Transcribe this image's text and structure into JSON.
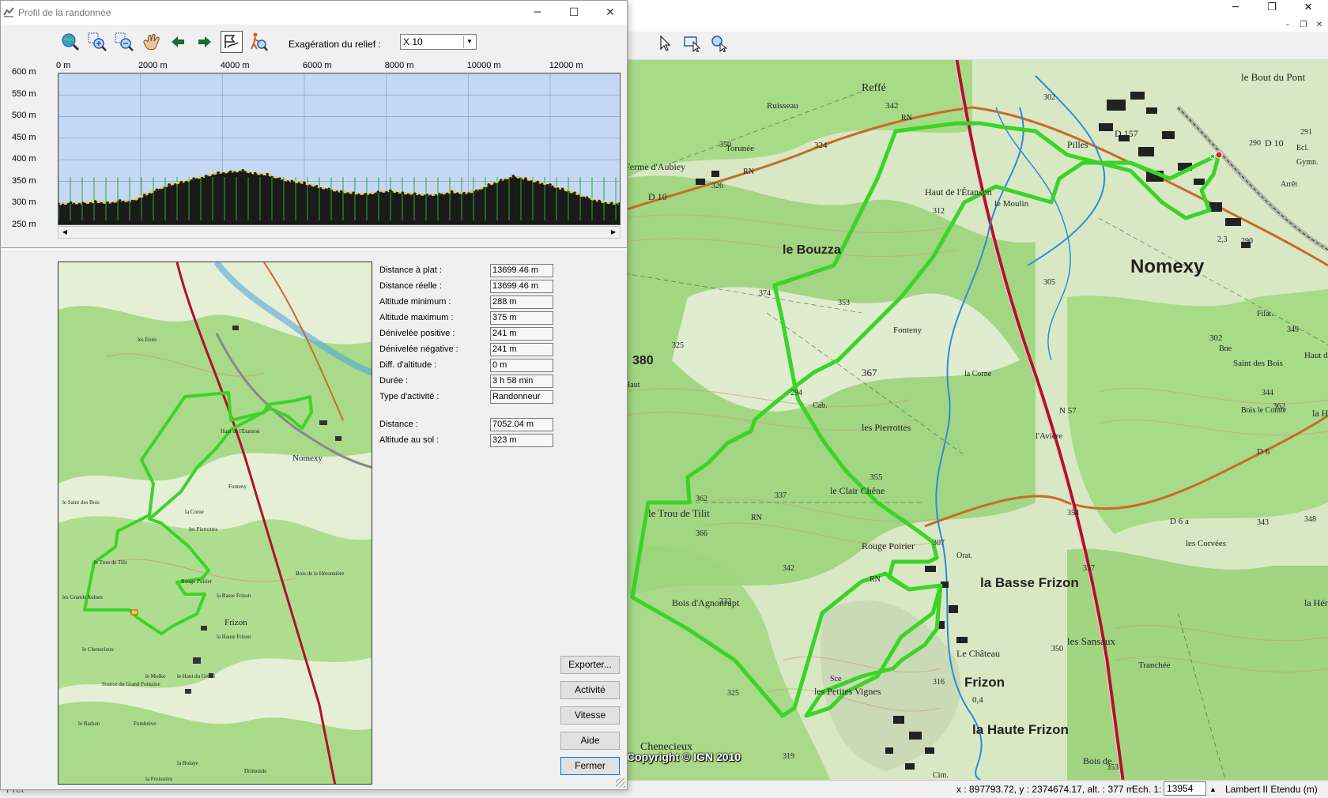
{
  "main_window": {
    "controls": {
      "minimize": "─",
      "maximize": "❐",
      "close": "✕"
    },
    "mdi_controls": {
      "minimize": "–",
      "restore": "❐",
      "close": "✕"
    }
  },
  "map": {
    "copyright": "Copyright © IGN 2010",
    "labels": [
      "Reffé",
      "342",
      "RN",
      "324",
      "Ruisseau",
      "350",
      "Ferme d'Aubiey",
      "Torunée",
      "326",
      "D 10",
      "RN",
      "le Bout du Pont",
      "302",
      "Pilles",
      "D 157",
      "291",
      "D 10",
      "290",
      "Ecl.",
      "Gymn.",
      "Arrêt",
      "Haut de l'Étanson",
      "312",
      "le Moulin",
      "le Bouzza",
      "Nomexy",
      "2,3",
      "290",
      "305",
      "374",
      "353",
      "Fonteny",
      "Filat.",
      "302",
      "Bne",
      "349",
      "325",
      "380",
      "Saint des Bois",
      "Haut du Camp",
      "Haut",
      "367",
      "la Corne",
      "294",
      "Cab.",
      "362",
      "Bois le Comte",
      "344",
      "la Héronnière",
      "les Pierrottes",
      "N 57",
      "D 6",
      "l'Avière",
      "355",
      "le Clair Chêne",
      "337",
      "362",
      "le Trou de Tilit",
      "RN",
      "366",
      "D 6 a",
      "les Corvées",
      "354",
      "348",
      "343",
      "Rouge Poirier",
      "307",
      "Orat.",
      "342",
      "RN",
      "la Basse Frizon",
      "357",
      "Bois d'Agnonrupt",
      "332",
      "la Héronnière",
      "les Sansaux",
      "Le Château",
      "Frizon",
      "0,4",
      "Sce",
      "les Petites Vignes",
      "316",
      "325",
      "Tranchée",
      "Bois de",
      "la Haute Frizon",
      "319",
      "Chenecieux",
      "353",
      "Cim.",
      "350"
    ]
  },
  "status_bar": {
    "coords": "x : 897793.72, y : 2374674.17, alt. : 377 m",
    "scale_label": "Ech. 1:",
    "scale_value": "13954",
    "projection": "Lambert II Etendu (m)",
    "left_text": "Prêt"
  },
  "dialog": {
    "title": "Profil de la randonnée",
    "controls": {
      "minimize": "─",
      "maximize": "☐",
      "close": "✕"
    },
    "toolbar_icons": [
      "globe-zoom-icon",
      "zoom-in-icon",
      "zoom-out-icon",
      "hand-pan-icon",
      "arrow-left-icon",
      "arrow-right-icon",
      "profile-flag-icon",
      "hiker-search-icon"
    ],
    "relief_label": "Exagération du relief :",
    "relief_value": "X 10",
    "x_ticks": [
      "0 m",
      "2000 m",
      "4000 m",
      "6000 m",
      "8000 m",
      "10000 m",
      "12000 m"
    ],
    "y_ticks": [
      "600 m",
      "550 m",
      "500 m",
      "450 m",
      "400 m",
      "350 m",
      "300 m",
      "250 m"
    ],
    "stats": [
      {
        "label": "Distance à plat :",
        "value": "13699.46 m"
      },
      {
        "label": "Distance réelle :",
        "value": "13699.46 m"
      },
      {
        "label": "Altitude minimum :",
        "value": "288 m"
      },
      {
        "label": "Altitude maximum :",
        "value": "375 m"
      },
      {
        "label": "Dénivelée positive :",
        "value": "241 m"
      },
      {
        "label": "Dénivelée négative :",
        "value": "241 m"
      },
      {
        "label": "Diff. d'altitude :",
        "value": "0 m"
      },
      {
        "label": "Durée :",
        "value": "3 h 58 min"
      },
      {
        "label": "Type d'activité :",
        "value": "Randonneur"
      }
    ],
    "stats2": [
      {
        "label": "Distance :",
        "value": "7052.04 m"
      },
      {
        "label": "Altitude au sol :",
        "value": "323 m"
      }
    ],
    "buttons": {
      "export": "Exporter...",
      "activity": "Activité",
      "speed": "Vitesse",
      "help": "Aide",
      "close": "Fermer"
    },
    "mini_map_labels": [
      "les Etots",
      "Nomexy",
      "la Basse Frizon",
      "Frizon",
      "la Haute Frizon",
      "le Saint des Bois",
      "le Chenecieux",
      "le Trou de Tilit",
      "Rouge Poirier",
      "Haut de l'Étanson",
      "Fonteny",
      "la Corne",
      "les Pierrottes",
      "Bois de la Héronnière",
      "le Haut du Grésil",
      "Fombrève",
      "la Bolaye",
      "le Barban",
      "Source du Grand Fontaine",
      "les Grands Aulnes",
      "le Molko",
      "la Froissière",
      "Drimonde"
    ]
  },
  "chart_data": {
    "type": "area",
    "title": "",
    "xlabel": "",
    "ylabel": "",
    "xlim": [
      0,
      13699
    ],
    "ylim": [
      250,
      600
    ],
    "x": [
      0,
      300,
      600,
      900,
      1200,
      1500,
      1800,
      2100,
      2400,
      2700,
      3000,
      3300,
      3600,
      3900,
      4200,
      4500,
      4800,
      5100,
      5400,
      5700,
      6000,
      6300,
      6600,
      6900,
      7200,
      7500,
      7800,
      8100,
      8400,
      8700,
      9000,
      9300,
      9600,
      9900,
      10200,
      10500,
      10800,
      11100,
      11400,
      11700,
      12000,
      12300,
      12600,
      12900,
      13200,
      13500,
      13699
    ],
    "y": [
      297,
      300,
      299,
      303,
      300,
      305,
      304,
      318,
      330,
      342,
      348,
      356,
      362,
      370,
      372,
      375,
      368,
      366,
      356,
      350,
      346,
      338,
      332,
      326,
      323,
      320,
      325,
      328,
      323,
      321,
      318,
      320,
      326,
      322,
      328,
      342,
      352,
      362,
      356,
      348,
      342,
      332,
      323,
      312,
      304,
      299,
      298
    ]
  }
}
